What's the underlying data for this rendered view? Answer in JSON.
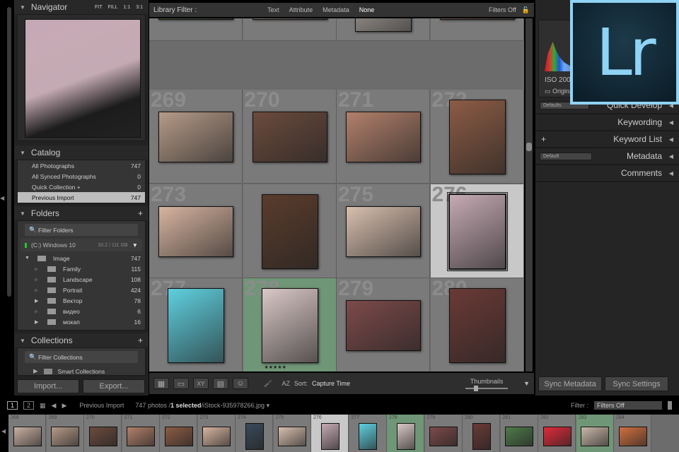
{
  "navigator": {
    "title": "Navigator",
    "zoom_options": [
      "FIT",
      "FILL",
      "1:1",
      "3:1"
    ]
  },
  "catalog": {
    "title": "Catalog",
    "items": [
      {
        "label": "All Photographs",
        "count": "747"
      },
      {
        "label": "All Synced Photographs",
        "count": "0"
      },
      {
        "label": "Quick Collection +",
        "count": "0"
      },
      {
        "label": "Previous Import",
        "count": "747",
        "selected": true
      }
    ]
  },
  "folders": {
    "title": "Folders",
    "filter_placeholder": "Filter Folders",
    "volume": {
      "name": "(C:) Windows 10",
      "size": "33.2 / 111 GB"
    },
    "items": [
      {
        "label": "Image",
        "count": "747",
        "level": 0,
        "expanded": true
      },
      {
        "label": "Family",
        "count": "115",
        "level": 1
      },
      {
        "label": "Landscape",
        "count": "108",
        "level": 1
      },
      {
        "label": "Portrait",
        "count": "424",
        "level": 1
      },
      {
        "label": "Вектор",
        "count": "78",
        "level": 1,
        "has_children": true
      },
      {
        "label": "видео",
        "count": "6",
        "level": 1
      },
      {
        "label": "мокап",
        "count": "16",
        "level": 1,
        "has_children": true
      }
    ]
  },
  "collections": {
    "title": "Collections",
    "filter_placeholder": "Filter Collections",
    "items": [
      {
        "label": "Smart Collections"
      }
    ]
  },
  "left_buttons": {
    "import": "Import...",
    "export": "Export..."
  },
  "filter_bar": {
    "title": "Library Filter :",
    "tabs": [
      "Text",
      "Attribute",
      "Metadata",
      "None"
    ],
    "active": "None",
    "status": "Filters Off"
  },
  "grid": {
    "rows": [
      [
        {
          "num": "",
          "o": "l",
          "c": "#5a7a45"
        },
        {
          "num": "",
          "o": "l",
          "c": "#b9a49a"
        },
        {
          "num": "",
          "o": "p",
          "c": "#cfc5bd"
        },
        {
          "num": "",
          "o": "l",
          "c": "#a48068"
        }
      ],
      [
        {
          "num": "269",
          "o": "l",
          "c": "#b59a88"
        },
        {
          "num": "270",
          "o": "l",
          "c": "#6b4b3d"
        },
        {
          "num": "271",
          "o": "l",
          "c": "#b2806b"
        },
        {
          "num": "272",
          "o": "p",
          "c": "#8c5c45"
        }
      ],
      [
        {
          "num": "273",
          "o": "l",
          "c": "#d7b4a0"
        },
        {
          "num": "",
          "o": "p",
          "c": "#5a3c2c"
        },
        {
          "num": "275",
          "o": "l",
          "c": "#d8bfae"
        },
        {
          "num": "276",
          "o": "p",
          "c": "#c5aab4",
          "selected": true
        }
      ],
      [
        {
          "num": "277",
          "o": "p",
          "c": "#5fd0df"
        },
        {
          "num": "278",
          "o": "p",
          "c": "#d9c8c6",
          "green": true,
          "rating": "★★★★★"
        },
        {
          "num": "279",
          "o": "l",
          "c": "#7d4a4a"
        },
        {
          "num": "280",
          "o": "p",
          "c": "#6a3a36"
        }
      ]
    ]
  },
  "toolbar": {
    "sort_label": "Sort:",
    "sort_value": "Capture Time",
    "thumbnails_label": "Thumbnails",
    "thumb_size": 0.2
  },
  "right_panel": {
    "histogram_iso": "ISO 200",
    "original_label": "Original",
    "defaults": "Defaults",
    "quick_develop": "Quick Develop",
    "keywording": "Keywording",
    "keyword_list": "Keyword List",
    "metadata_preset": "Default",
    "metadata": "Metadata",
    "comments": "Comments",
    "sync_metadata": "Sync Metadata",
    "sync_settings": "Sync Settings"
  },
  "logo": {
    "text": "Lr",
    "bg": "#0e2430",
    "accent": "#8fd3f5"
  },
  "filmstrip_bar": {
    "screen1": "1",
    "screen2": "2",
    "source": "Previous Import",
    "count": "747 photos /",
    "selected": "1 selected",
    "file": "/iStock-935978266.jpg",
    "filter_label": "Filter :",
    "filter_value": "Filters Off"
  },
  "filmstrip": [
    {
      "num": "268",
      "c": "#c9b0a3"
    },
    {
      "num": "269",
      "c": "#b59a88"
    },
    {
      "num": "270",
      "c": "#6b4b3d"
    },
    {
      "num": "271",
      "c": "#b2806b"
    },
    {
      "num": "272",
      "c": "#8c5c45"
    },
    {
      "num": "273",
      "c": "#d7b4a0"
    },
    {
      "num": "274",
      "c": "#3a4a5a",
      "p": true
    },
    {
      "num": "275",
      "c": "#d8bfae"
    },
    {
      "num": "276",
      "c": "#c5aab4",
      "p": true,
      "selected": true
    },
    {
      "num": "277",
      "c": "#5fd0df",
      "p": true
    },
    {
      "num": "278",
      "c": "#d9c8c6",
      "p": true,
      "green": true
    },
    {
      "num": "279",
      "c": "#7d4a4a"
    },
    {
      "num": "280",
      "c": "#6a3a36",
      "p": true
    },
    {
      "num": "281",
      "c": "#4f7a4a"
    },
    {
      "num": "282",
      "c": "#e02a3a"
    },
    {
      "num": "283",
      "c": "#c9b7a8",
      "green": true
    },
    {
      "num": "284",
      "c": "#d07040"
    }
  ]
}
